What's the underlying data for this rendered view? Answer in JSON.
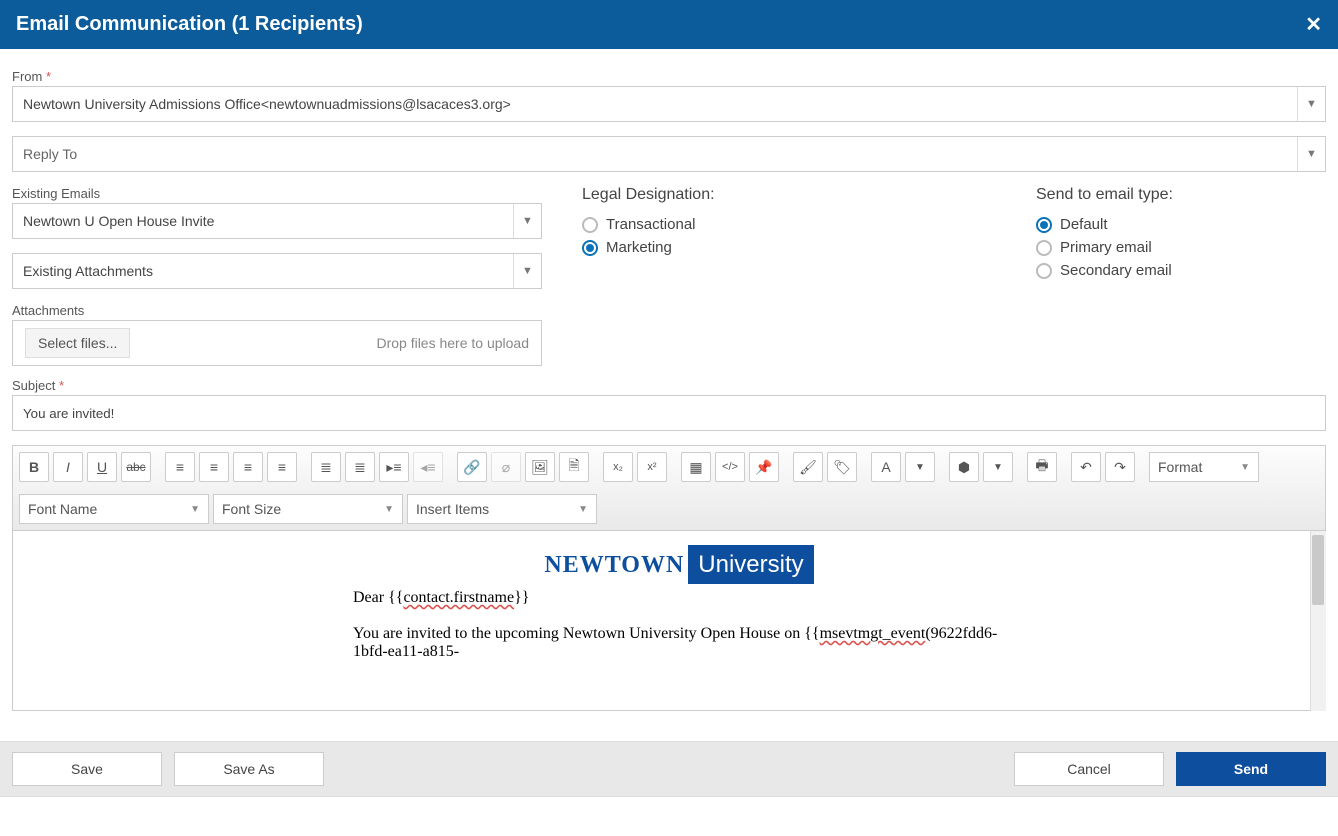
{
  "header": {
    "title": "Email Communication (1 Recipients)"
  },
  "from": {
    "label": "From",
    "value": "Newtown University Admissions Office<newtownuadmissions@lsacaces3.org>"
  },
  "replyTo": {
    "placeholder": "Reply To"
  },
  "existingEmails": {
    "label": "Existing Emails",
    "value": "Newtown U Open House Invite"
  },
  "existingAttachments": {
    "value": "Existing Attachments"
  },
  "attachments": {
    "label": "Attachments",
    "selectBtn": "Select files...",
    "dropHint": "Drop files here to upload"
  },
  "legal": {
    "title": "Legal Designation:",
    "options": [
      "Transactional",
      "Marketing"
    ],
    "selected": "Marketing"
  },
  "sendType": {
    "title": "Send to email type:",
    "options": [
      "Default",
      "Primary email",
      "Secondary email"
    ],
    "selected": "Default"
  },
  "subject": {
    "label": "Subject",
    "value": "You are invited!"
  },
  "toolbar2": {
    "fontName": "Font Name",
    "fontSize": "Font Size",
    "insertItems": "Insert Items",
    "format": "Format"
  },
  "editor": {
    "logoLeft": "NEWTOWN",
    "logoRight": "University",
    "greeting_pre": "Dear {{",
    "greeting_token": "contact.firstname",
    "greeting_post": "}}",
    "line2a": "You are invited to the upcoming Newtown University Open House on {{",
    "line2token": "msevtmgt_event",
    "line2b": "(9622fdd6-1bfd-ea11-a815-"
  },
  "footer": {
    "save": "Save",
    "saveAs": "Save As",
    "cancel": "Cancel",
    "send": "Send"
  }
}
